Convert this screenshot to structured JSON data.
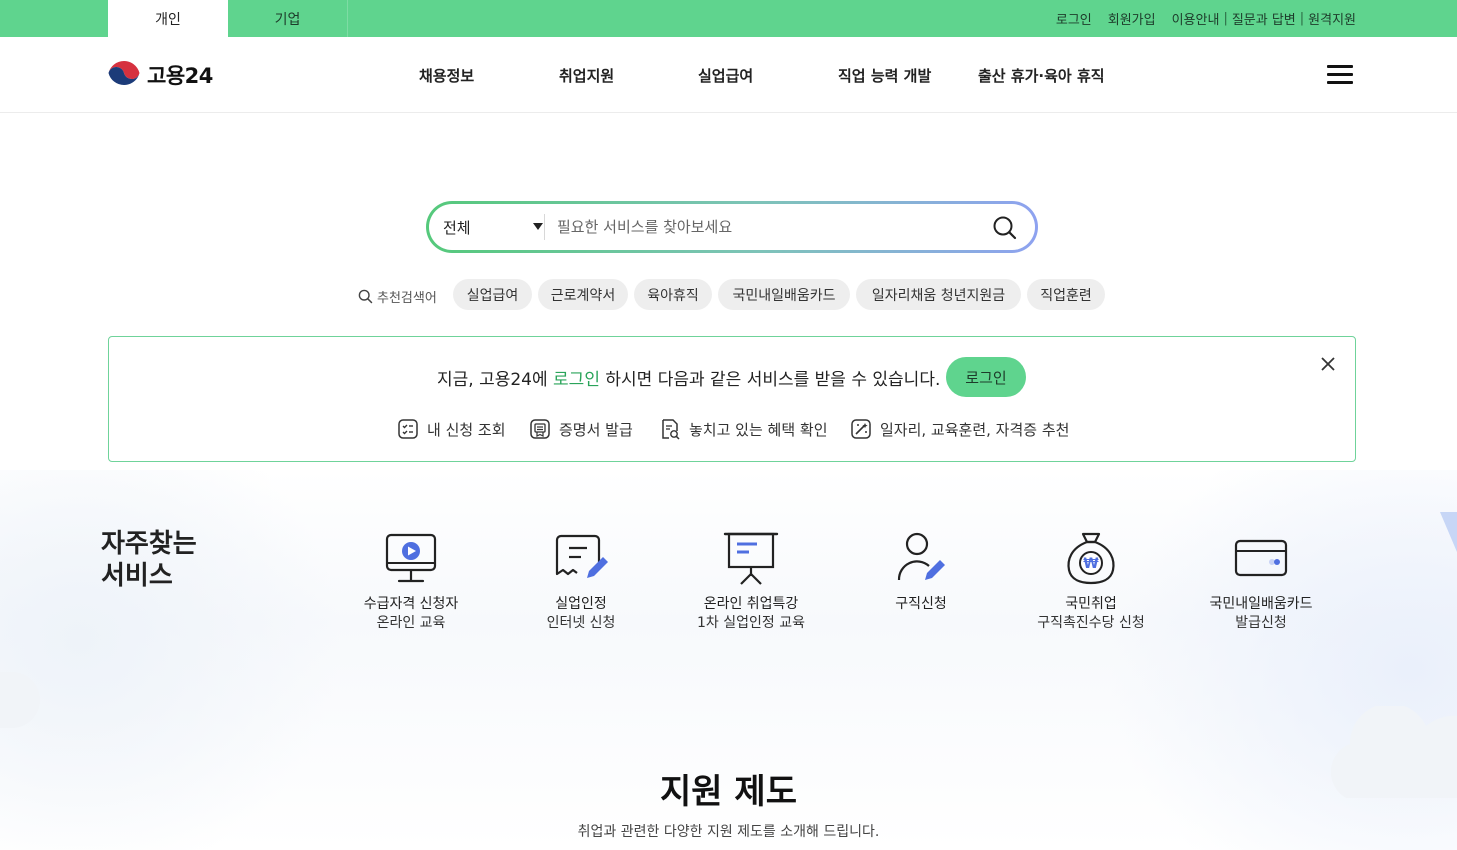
{
  "topbar": {
    "tabs": [
      {
        "label": "개인",
        "active": true
      },
      {
        "label": "기업",
        "active": false
      }
    ],
    "links": [
      "로그인",
      "회원가입",
      "이용안내",
      "질문과 답변",
      "원격지원"
    ],
    "color": "#5fd48e"
  },
  "header": {
    "logo_text": "고용24",
    "nav": [
      "채용정보",
      "취업지원",
      "실업급여",
      "직업 능력 개발",
      "출산 휴가·육아 휴직"
    ],
    "menu_icon": "hamburger-icon"
  },
  "search": {
    "category": "전체",
    "placeholder": "필요한 서비스를 찾아보세요",
    "value": "",
    "icon": "search-icon"
  },
  "recommended": {
    "label": "추천검색어",
    "keywords": [
      "실업급여",
      "근로계약서",
      "육아휴직",
      "국민내일배움카드",
      "일자리채움 청년지원금",
      "직업훈련"
    ]
  },
  "notice": {
    "msg_prefix": "지금, 고용24에 ",
    "msg_highlight": "로그인",
    "msg_suffix": " 하시면 다음과 같은 서비스를 받을 수 있습니다.",
    "login_button": "로그인",
    "benefits": [
      {
        "label": "내 신청 조회",
        "icon": "checklist-icon"
      },
      {
        "label": "증명서 발급",
        "icon": "certificate-icon"
      },
      {
        "label": "놓치고 있는 혜택 확인",
        "icon": "document-search-icon"
      },
      {
        "label": "일자리, 교육훈련, 자격증 추천",
        "icon": "magic-wand-icon"
      }
    ],
    "accent_color": "#2aa45a"
  },
  "frequent": {
    "title_line1": "자주찾는",
    "title_line2": "서비스",
    "items": [
      {
        "line1": "수급자격 신청자",
        "line2": "온라인 교육",
        "icon": "video-monitor-icon"
      },
      {
        "line1": "실업인정",
        "line2": "인터넷 신청",
        "icon": "document-edit-icon"
      },
      {
        "line1": "온라인 취업특강",
        "line2": "1차 실업인정 교육",
        "icon": "presentation-board-icon"
      },
      {
        "line1": "구직신청",
        "line2": "",
        "icon": "person-edit-icon"
      },
      {
        "line1": "국민취업",
        "line2": "구직촉진수당 신청",
        "icon": "money-bag-icon"
      },
      {
        "line1": "국민내일배움카드",
        "line2": "발급신청",
        "icon": "credit-card-icon"
      }
    ],
    "icon_accent": "#4f6fe0"
  },
  "support": {
    "title": "지원 제도",
    "description": "취업과 관련한 다양한 지원 제도를 소개해 드립니다."
  }
}
